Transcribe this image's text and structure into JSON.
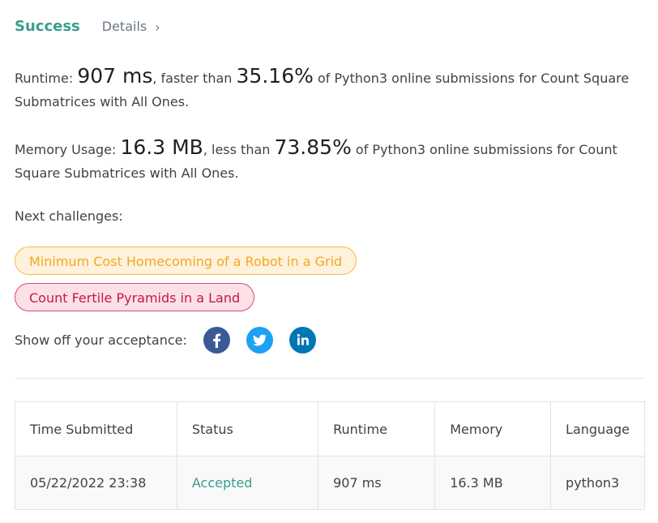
{
  "header": {
    "status": "Success",
    "details_label": "Details",
    "details_chevron": "›"
  },
  "runtime": {
    "label": "Runtime: ",
    "value": "907 ms",
    "mid": ", faster than ",
    "percent": "35.16%",
    "suffix": " of Python3 online submissions for Count Square Submatrices with All Ones."
  },
  "memory": {
    "label": "Memory Usage: ",
    "value": "16.3 MB",
    "mid": ", less than ",
    "percent": "73.85%",
    "suffix": " of Python3 online submissions for Count Square Submatrices with All Ones."
  },
  "next_challenges": {
    "label": "Next challenges:",
    "items": [
      {
        "title": "Minimum Cost Homecoming of a Robot in a Grid",
        "difficulty_color": "#f5a623"
      },
      {
        "title": "Count Fertile Pyramids in a Land",
        "difficulty_color": "#c6184a"
      }
    ]
  },
  "share": {
    "label": "Show off your acceptance:",
    "icons": [
      "facebook-icon",
      "twitter-icon",
      "linkedin-icon"
    ]
  },
  "table": {
    "headers": [
      "Time Submitted",
      "Status",
      "Runtime",
      "Memory",
      "Language"
    ],
    "rows": [
      [
        "05/22/2022 23:38",
        "Accepted",
        "907 ms",
        "16.3 MB",
        "python3"
      ]
    ]
  },
  "colors": {
    "accent": "#3a9e8c",
    "facebook": "#3b5998",
    "twitter": "#1da1f2",
    "linkedin": "#0077b5"
  }
}
